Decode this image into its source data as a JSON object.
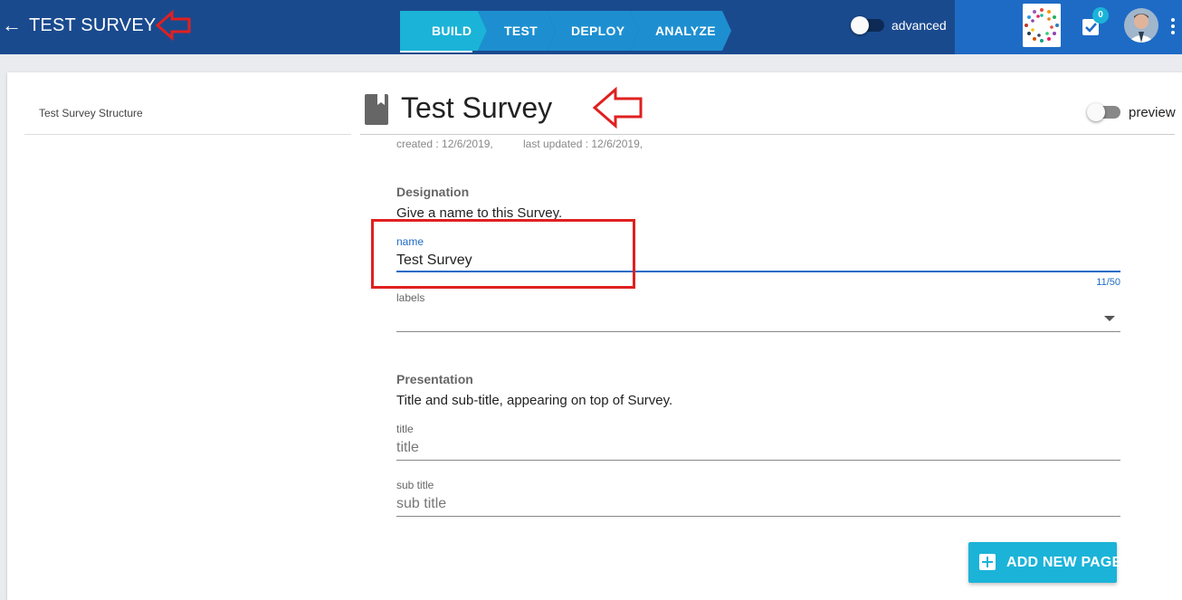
{
  "header": {
    "back_icon": "arrow-left-icon",
    "app_title": "TEST SURVEY",
    "steps": [
      {
        "label": "BUILD",
        "active": true
      },
      {
        "label": "TEST",
        "active": false
      },
      {
        "label": "DEPLOY",
        "active": false
      },
      {
        "label": "ANALYZE",
        "active": false
      }
    ],
    "advanced_label": "advanced",
    "advanced_on": false,
    "tasks_badge": "0"
  },
  "sidebar": {
    "title": "Test Survey Structure"
  },
  "survey": {
    "title": "Test Survey",
    "created": "created : 12/6/2019,",
    "updated": "last updated : 12/6/2019,",
    "preview_label": "preview",
    "preview_on": false
  },
  "designation": {
    "heading": "Designation",
    "description": "Give a name to this Survey.",
    "name_label": "name",
    "name_value": "Test Survey",
    "name_counter": "11/50",
    "labels_label": "labels"
  },
  "presentation": {
    "heading": "Presentation",
    "description": "Title and sub-title, appearing on top of Survey.",
    "title_label": "title",
    "title_placeholder": "title",
    "subtitle_label": "sub title",
    "subtitle_placeholder": "sub title"
  },
  "actions": {
    "add_page_label": "ADD NEW PAGE"
  },
  "colors": {
    "header_bg": "#1a4a8e",
    "header_right_bg": "#1e6bc6",
    "step_active": "#1bb3d8",
    "step_inactive": "#1d8fd0",
    "accent": "#1bb3d8",
    "annotation_red": "#e02020"
  }
}
